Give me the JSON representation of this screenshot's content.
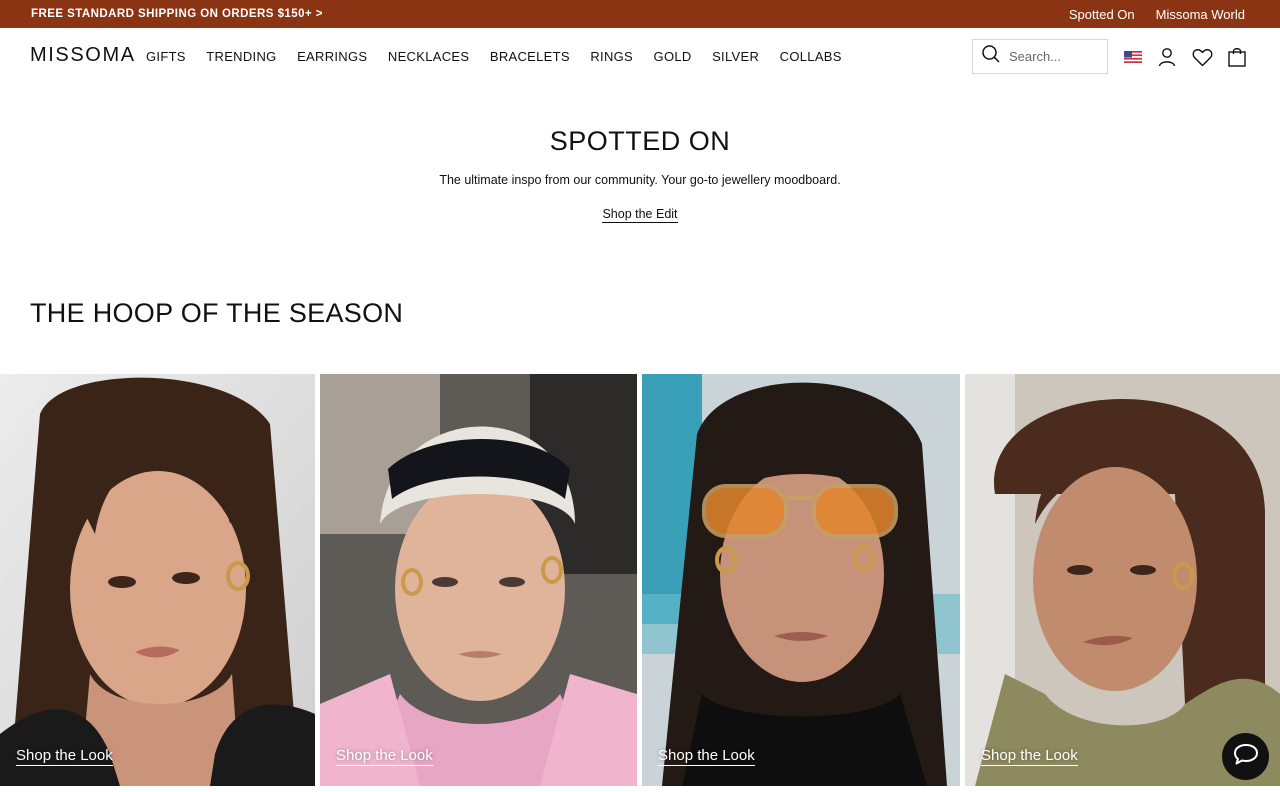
{
  "announcement": {
    "promo": "FREE STANDARD SHIPPING ON ORDERS $150+ >",
    "links": [
      "Spotted On",
      "Missoma World"
    ]
  },
  "header": {
    "logo": "MISSOMA",
    "nav": [
      "GIFTS",
      "TRENDING",
      "EARRINGS",
      "NECKLACES",
      "BRACELETS",
      "RINGS",
      "GOLD",
      "SILVER",
      "COLLABS"
    ],
    "search_placeholder": "Search...",
    "icons": [
      "us-flag-icon",
      "account-icon",
      "wishlist-heart-icon",
      "shopping-bag-icon"
    ]
  },
  "hero": {
    "title": "SPOTTED ON",
    "subtitle": "The ultimate inspo from our community. Your go-to jewellery moodboard.",
    "link": "Shop the Edit"
  },
  "section": {
    "title": "THE HOOP OF THE SEASON",
    "tiles": [
      {
        "link": "Shop the Look",
        "subject": "woman with long dark hair and gold hoop earrings"
      },
      {
        "link": "Shop the Look",
        "subject": "platinum-haired woman with black headband and gold hoops"
      },
      {
        "link": "Shop the Look",
        "subject": "woman with amber aviator sunglasses and gold hoops"
      },
      {
        "link": "Shop the Look",
        "subject": "woman with curly hair and gold hoop earrings"
      }
    ]
  },
  "colors": {
    "announcement_bg": "#8b3413",
    "text": "#111111",
    "chat_button": "#111111"
  },
  "chat": {
    "icon": "chat-bubble-icon"
  }
}
